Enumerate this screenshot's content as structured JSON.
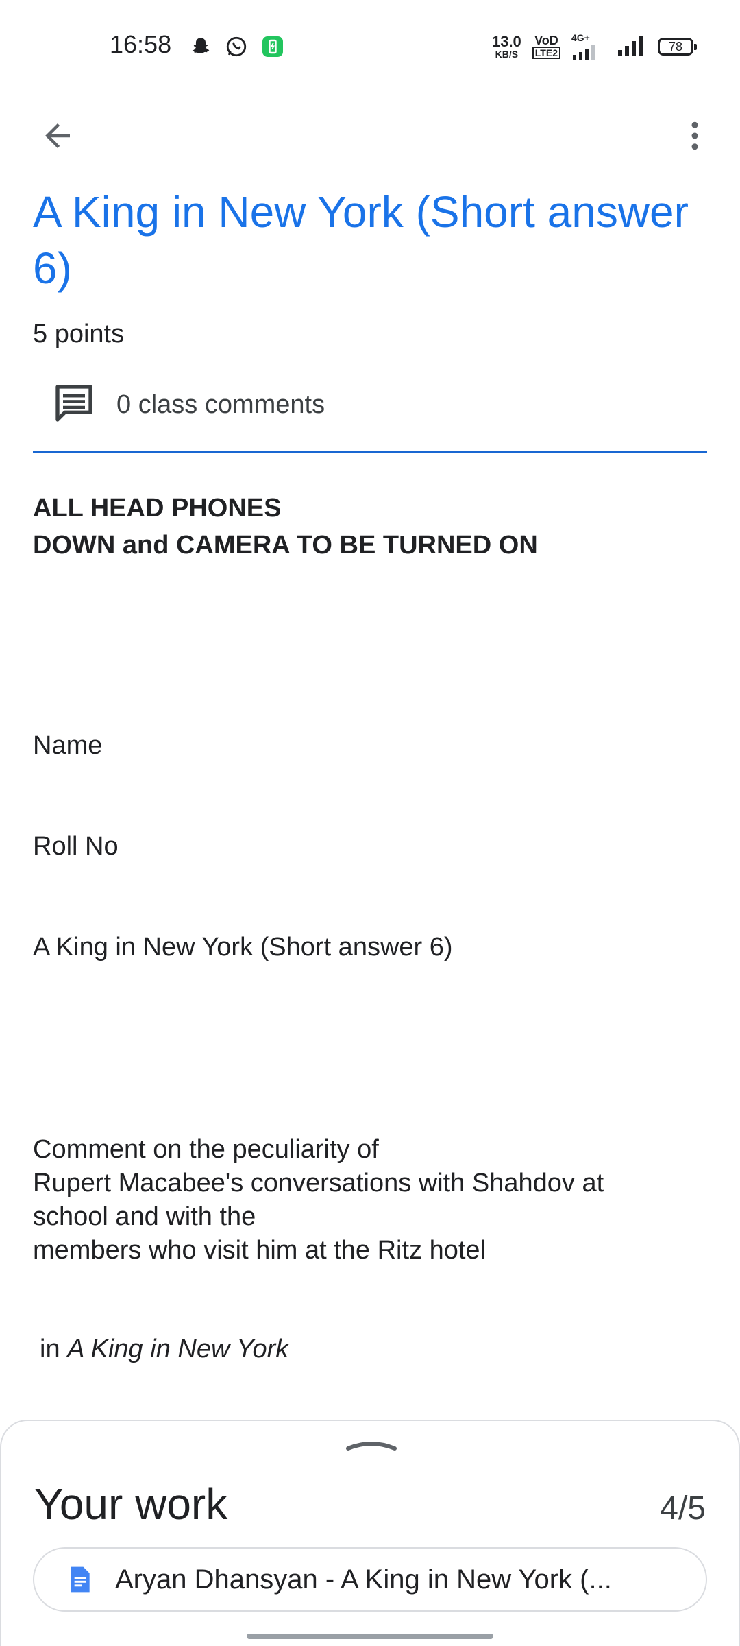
{
  "status_bar": {
    "time": "16:58",
    "net_speed_value": "13.0",
    "net_speed_unit": "KB/S",
    "volte_top": "VoD",
    "volte_bottom": "LTE2",
    "network_type": "4G+",
    "battery": "78",
    "icons": [
      "snapchat-icon",
      "whatsapp-icon",
      "battery-saver-app-icon",
      "signal-sim1-icon",
      "signal-sim2-icon"
    ]
  },
  "app_bar": {
    "back_icon": "arrow-back-icon",
    "more_icon": "more-vert-icon"
  },
  "assignment": {
    "title": "A King in New York (Short answer 6)",
    "points": "5 points",
    "comments": "0 class comments",
    "accent_color": "#1a73e8"
  },
  "description": {
    "instructions_line1": "ALL HEAD PHONES",
    "instructions_line2": "DOWN and CAMERA TO BE TURNED ON",
    "name_label": "Name",
    "roll_label": "Roll No",
    "subtitle": "A King in New York (Short answer 6)",
    "question_lines": [
      "Comment on the peculiarity of",
      "Rupert Macabee's conversations  with Shahdov at",
      "school and with the",
      "members who visit him at the Ritz hotel"
    ],
    "question_tail_prefix": "in",
    "question_tail_italic": "A King in New York"
  },
  "your_work": {
    "title": "Your work",
    "count": "4/5",
    "attachment": "Aryan Dhansyan - A King in New York (..."
  }
}
